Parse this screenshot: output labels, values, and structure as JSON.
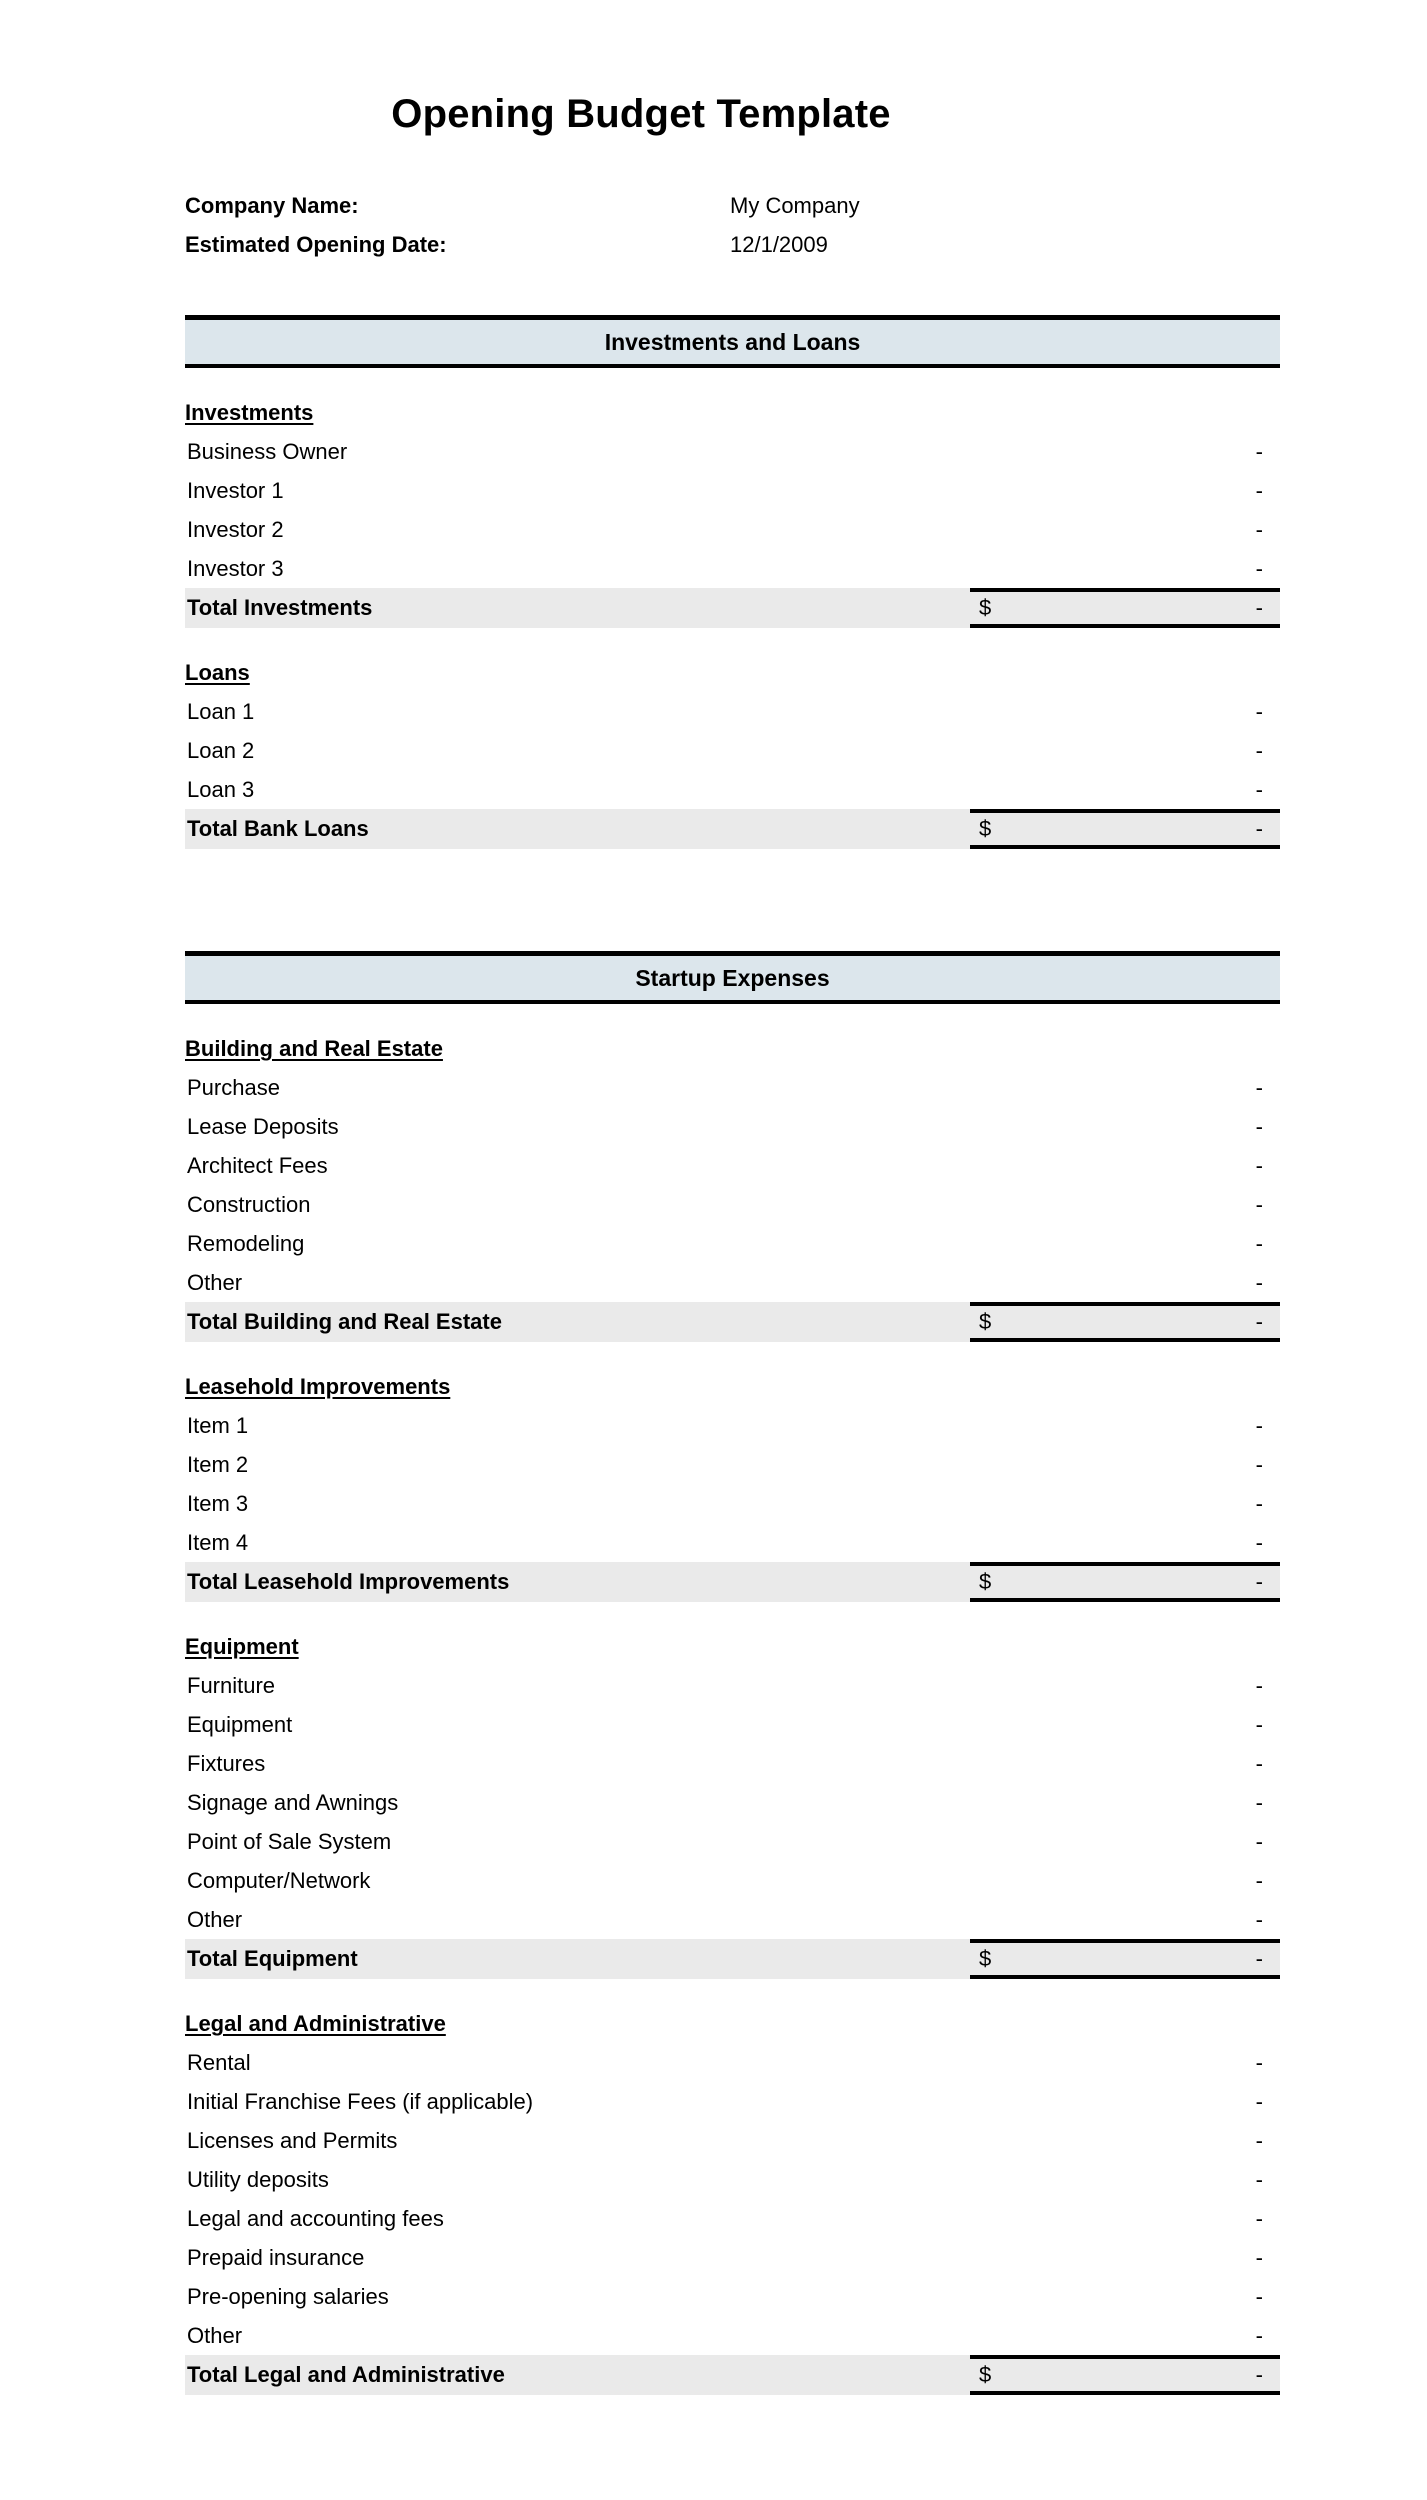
{
  "document": {
    "title": "Opening Budget Template"
  },
  "meta": {
    "company_name_label": "Company Name:",
    "company_name_value": "My Company",
    "opening_date_label": "Estimated Opening Date:",
    "opening_date_value": "12/1/2009"
  },
  "currency_symbol": "$",
  "empty_value": "-",
  "sections": [
    {
      "banner": "Investments and Loans",
      "groups": [
        {
          "title": "Investments",
          "items": [
            {
              "label": "Business Owner",
              "value": "-"
            },
            {
              "label": "Investor 1",
              "value": "-"
            },
            {
              "label": "Investor 2",
              "value": "-"
            },
            {
              "label": "Investor 3",
              "value": "-"
            }
          ],
          "total": {
            "label": "Total Investments",
            "currency": "$",
            "value": "-"
          }
        },
        {
          "title": "Loans",
          "items": [
            {
              "label": "Loan 1",
              "value": "-"
            },
            {
              "label": "Loan 2",
              "value": "-"
            },
            {
              "label": "Loan 3",
              "value": "-"
            }
          ],
          "total": {
            "label": "Total Bank Loans",
            "currency": "$",
            "value": "-"
          }
        }
      ]
    },
    {
      "banner": "Startup Expenses",
      "groups": [
        {
          "title": "Building and Real Estate",
          "items": [
            {
              "label": "Purchase",
              "value": "-"
            },
            {
              "label": "Lease Deposits",
              "value": "-"
            },
            {
              "label": "Architect Fees",
              "value": "-"
            },
            {
              "label": "Construction",
              "value": "-"
            },
            {
              "label": "Remodeling",
              "value": "-"
            },
            {
              "label": "Other",
              "value": "-"
            }
          ],
          "total": {
            "label": "Total Building and Real Estate",
            "currency": "$",
            "value": "-"
          }
        },
        {
          "title": "Leasehold Improvements",
          "items": [
            {
              "label": "Item 1",
              "value": "-"
            },
            {
              "label": "Item 2",
              "value": "-"
            },
            {
              "label": "Item 3",
              "value": "-"
            },
            {
              "label": "Item 4",
              "value": "-"
            }
          ],
          "total": {
            "label": "Total Leasehold Improvements",
            "currency": "$",
            "value": "-"
          }
        },
        {
          "title": "Equipment",
          "items": [
            {
              "label": "Furniture",
              "value": "-"
            },
            {
              "label": "Equipment",
              "value": "-"
            },
            {
              "label": "Fixtures",
              "value": "-"
            },
            {
              "label": "Signage and Awnings",
              "value": "-"
            },
            {
              "label": "Point of Sale System",
              "value": "-"
            },
            {
              "label": "Computer/Network",
              "value": "-"
            },
            {
              "label": "Other",
              "value": "-"
            }
          ],
          "total": {
            "label": "Total Equipment",
            "currency": "$",
            "value": "-"
          }
        },
        {
          "title": "Legal and Administrative",
          "items": [
            {
              "label": "Rental",
              "value": "-"
            },
            {
              "label": "Initial Franchise Fees (if applicable)",
              "value": "-"
            },
            {
              "label": "Licenses and Permits",
              "value": "-"
            },
            {
              "label": "Utility deposits",
              "value": "-"
            },
            {
              "label": "Legal and accounting fees",
              "value": "-"
            },
            {
              "label": "Prepaid insurance",
              "value": "-"
            },
            {
              "label": "Pre-opening salaries",
              "value": "-"
            },
            {
              "label": "Other",
              "value": "-"
            }
          ],
          "total": {
            "label": "Total Legal and Administrative",
            "currency": "$",
            "value": "-"
          }
        }
      ]
    }
  ]
}
